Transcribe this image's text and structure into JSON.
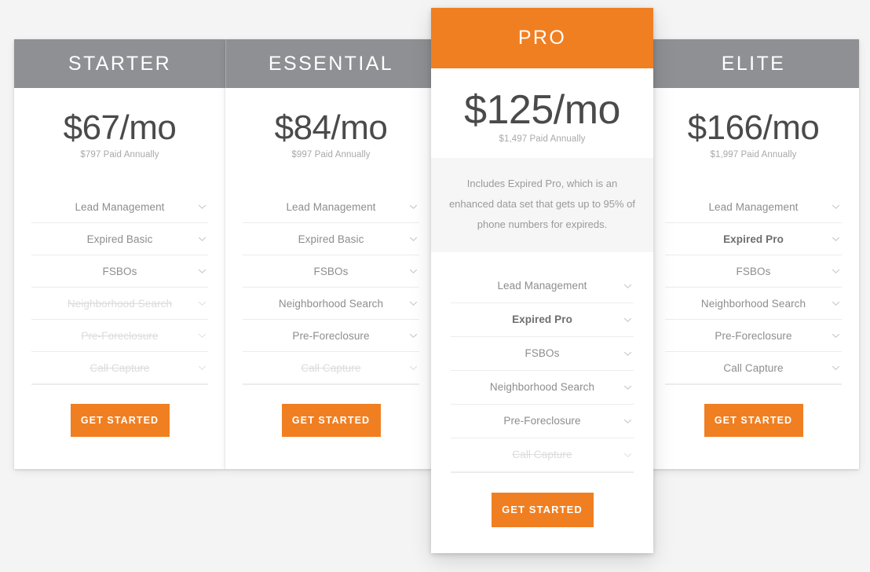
{
  "theme": {
    "page_background": "#f4f4f4",
    "header_gray": "#8e9093",
    "accent_orange": "#f07f22",
    "card_white": "#ffffff",
    "note_background": "#f6f6f6",
    "text_muted": "#8d8d8d",
    "text_disabled": "#dcdcdc"
  },
  "plans": [
    {
      "name": "STARTER",
      "price": "$67/mo",
      "annual": "$797 Paid Annually",
      "featured": false,
      "note": "",
      "cta_label": "GET STARTED",
      "features": [
        {
          "label": "Lead Management",
          "state": "active",
          "icon": "chevron-down-icon"
        },
        {
          "label": "Expired Basic",
          "state": "active",
          "icon": "chevron-down-icon"
        },
        {
          "label": "FSBOs",
          "state": "active",
          "icon": "chevron-down-icon"
        },
        {
          "label": "Neighborhood Search",
          "state": "disabled",
          "icon": "chevron-down-icon"
        },
        {
          "label": "Pre-Foreclosure",
          "state": "disabled",
          "icon": "chevron-down-icon"
        },
        {
          "label": "Call Capture",
          "state": "disabled",
          "icon": "chevron-down-icon"
        }
      ]
    },
    {
      "name": "ESSENTIAL",
      "price": "$84/mo",
      "annual": "$997 Paid Annually",
      "featured": false,
      "note": "",
      "cta_label": "GET STARTED",
      "features": [
        {
          "label": "Lead Management",
          "state": "active",
          "icon": "chevron-down-icon"
        },
        {
          "label": "Expired Basic",
          "state": "active",
          "icon": "chevron-down-icon"
        },
        {
          "label": "FSBOs",
          "state": "active",
          "icon": "chevron-down-icon"
        },
        {
          "label": "Neighborhood Search",
          "state": "active",
          "icon": "chevron-down-icon"
        },
        {
          "label": "Pre-Foreclosure",
          "state": "active",
          "icon": "chevron-down-icon"
        },
        {
          "label": "Call Capture",
          "state": "disabled",
          "icon": "chevron-down-icon"
        }
      ]
    },
    {
      "name": "PRO",
      "price": "$125/mo",
      "annual": "$1,497 Paid Annually",
      "featured": true,
      "note": "Includes Expired Pro, which is an enhanced data set that gets up to 95% of phone numbers for expireds.",
      "cta_label": "GET STARTED",
      "features": [
        {
          "label": "Lead Management",
          "state": "active",
          "icon": "chevron-down-icon"
        },
        {
          "label": "Expired Pro",
          "state": "highlighted",
          "icon": "chevron-down-icon"
        },
        {
          "label": "FSBOs",
          "state": "active",
          "icon": "chevron-down-icon"
        },
        {
          "label": "Neighborhood Search",
          "state": "active",
          "icon": "chevron-down-icon"
        },
        {
          "label": "Pre-Foreclosure",
          "state": "active",
          "icon": "chevron-down-icon"
        },
        {
          "label": "Call Capture",
          "state": "disabled",
          "icon": "chevron-down-icon"
        }
      ]
    },
    {
      "name": "ELITE",
      "price": "$166/mo",
      "annual": "$1,997 Paid Annually",
      "featured": false,
      "note": "",
      "cta_label": "GET STARTED",
      "features": [
        {
          "label": "Lead Management",
          "state": "active",
          "icon": "chevron-down-icon"
        },
        {
          "label": "Expired Pro",
          "state": "highlighted",
          "icon": "chevron-down-icon"
        },
        {
          "label": "FSBOs",
          "state": "active",
          "icon": "chevron-down-icon"
        },
        {
          "label": "Neighborhood Search",
          "state": "active",
          "icon": "chevron-down-icon"
        },
        {
          "label": "Pre-Foreclosure",
          "state": "active",
          "icon": "chevron-down-icon"
        },
        {
          "label": "Call Capture",
          "state": "active",
          "icon": "chevron-down-icon"
        }
      ]
    }
  ]
}
